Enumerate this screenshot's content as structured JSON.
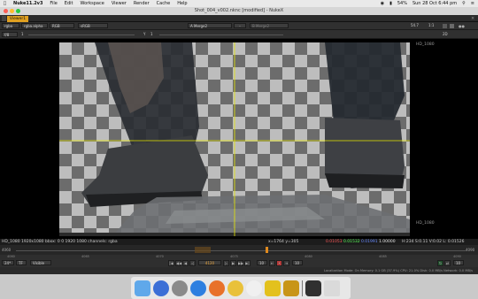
{
  "menubar": {
    "app": "Nuke11.2v3",
    "items": [
      "File",
      "Edit",
      "Workspace",
      "Viewer",
      "Render",
      "Cache",
      "Help"
    ],
    "battery": "54%",
    "clock": "Sun 28 Oct  6:44 pm"
  },
  "window": {
    "title": "Shot_004_v002.nknc [modified] - NukeX"
  },
  "viewer": {
    "tab_label": "Viewer1",
    "layer": "rgba",
    "channel": "rgba.alpha",
    "display_channels": "RGB",
    "colorspace": "sRGB",
    "input_a": "A  Merge2",
    "input_b": "B  Merge2",
    "input_separator": "-",
    "zoom": "54.7",
    "ratio": "1:1",
    "view_mode": "2D",
    "row2_left": "f/8",
    "row2_exposure": "1",
    "row2_gain_label": "Y",
    "row2_gain_value": "1",
    "format_name_top": "HD_1080",
    "format_name_bottom": "HD_1080"
  },
  "info": {
    "format": "HD_1080 1920x1080  bbox: 0 0 1920 1080  channels: rgba",
    "coords": "x=1764 y=305",
    "r": "0.01053",
    "g": "0.01532",
    "b": "0.01991",
    "a": "1.00000",
    "hsv": "H:234 S:0.11 V:0.02  L: 0.01526"
  },
  "timeline": {
    "start": "4060",
    "end": "4090",
    "ticks": [
      "4060",
      "4065",
      "4070",
      "4075",
      "4080",
      "4085",
      "4090"
    ],
    "fps": "24*",
    "range": "TF",
    "visible": "Visible",
    "current_frame": "4120",
    "step": "10",
    "end_frame": "10",
    "last": "10"
  },
  "status": "Localization Mode: On  Memory: 0.1 GB (37.9%)  CPU: 21.0%  Disk: 0.0 MB/s  Network: 0.0 MB/s",
  "dock": [
    "finder",
    "siri",
    "launchpad",
    "safari",
    "firefox",
    "chrome",
    "itunes",
    "nuke",
    "nuke-studio",
    "terminal",
    "trash"
  ]
}
